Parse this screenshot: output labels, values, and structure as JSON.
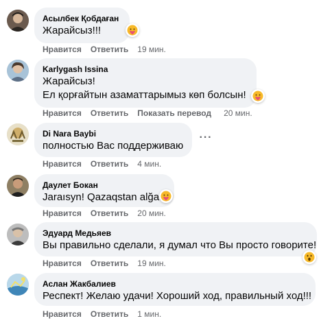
{
  "comments": [
    {
      "author": "Асылбек Қобдаған",
      "lines": [
        "Жарайсыз!!!"
      ],
      "actions": {
        "like": "Нравится",
        "reply": "Ответить",
        "translate": "",
        "time": "19 мин."
      },
      "reaction": "care-emoji-icon"
    },
    {
      "author": "Karlygash Issina",
      "lines": [
        "Жарайсыз!",
        "Ел қорғайтын азаматтарымыз көп болсын!"
      ],
      "actions": {
        "like": "Нравится",
        "reply": "Ответить",
        "translate": "Показать перевод",
        "time": "20 мин."
      },
      "reaction": "care-emoji-icon"
    },
    {
      "author": "Di Nara Baybi",
      "lines": [
        "полностью Вас поддерживаю"
      ],
      "actions": {
        "like": "Нравится",
        "reply": "Ответить",
        "translate": "",
        "time": "4 мин."
      },
      "reaction": ""
    },
    {
      "author": "Даулет Бокан",
      "lines": [
        "Jaraısyn! Qazaqstan alğa!"
      ],
      "actions": {
        "like": "Нравится",
        "reply": "Ответить",
        "translate": "",
        "time": "20 мин."
      },
      "reaction": "care-emoji-icon"
    },
    {
      "author": "Эдуард Медьяев",
      "lines": [
        "Вы правильно сделали, я думал что Вы просто говорите!"
      ],
      "actions": {
        "like": "Нравится",
        "reply": "Ответить",
        "translate": "",
        "time": "19 мин."
      },
      "reaction": "wow-emoji-icon"
    },
    {
      "author": "Аслан Жакбалиев",
      "lines": [
        "Респект! Желаю удачи! Хороший ход, правильный ход!!!"
      ],
      "actions": {
        "like": "Нравится",
        "reply": "Ответить",
        "translate": "",
        "time": "1 мин."
      },
      "reaction": ""
    }
  ],
  "colors": {
    "bubble": "#f0f2f5",
    "meta": "#65676b",
    "text": "#050505"
  }
}
